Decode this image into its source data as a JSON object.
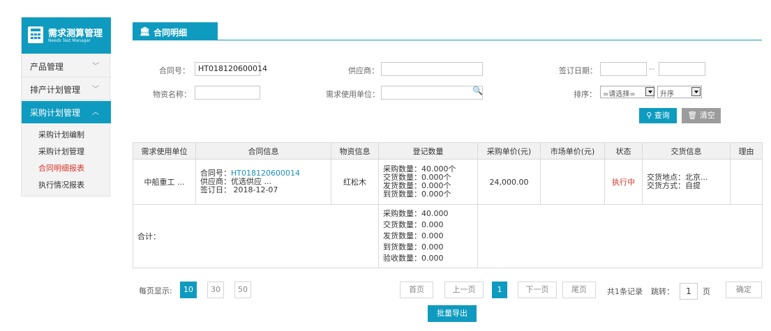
{
  "app": {
    "title": "需求测算管理",
    "subtitle": "Needs Test Manager"
  },
  "sidebar": {
    "menus": [
      {
        "label": "产品管理",
        "chevron": "﹀"
      },
      {
        "label": "排产计划管理",
        "chevron": "﹀"
      },
      {
        "label": "采购计划管理",
        "chevron": "︿"
      }
    ],
    "submenu": [
      "采购计划编制",
      "采购计划管理",
      "合同明细报表",
      "执行情况报表"
    ]
  },
  "header": {
    "tab_label": "合同明细",
    "tab_icon": "bank-icon"
  },
  "filters": {
    "contract_no_label": "合同号：",
    "contract_no_value": "HT018120600014",
    "supplier_label": "供应商：",
    "supplier_value": "",
    "sign_date_label": "签订日期：",
    "sign_date_sep": "--",
    "material_label": "物资名称：",
    "material_value": "",
    "unit_label": "需求使用单位：",
    "unit_value": "",
    "sort_label": "排序：",
    "sort_value": "=请选择=",
    "order_value": "升序",
    "query_label": "查询",
    "clear_label": "清空"
  },
  "table": {
    "headers": [
      "需求使用单位",
      "合同信息",
      "物资信息",
      "登记数量",
      "采购单价(元)",
      "市场单价(元)",
      "状态",
      "交货信息",
      "理由"
    ],
    "row": {
      "unit": "中船重工 ...",
      "contract_prefix": "合同号：",
      "contract_no": "HT018120600014",
      "supplier": "供应商：优选供应 ...",
      "sign_date": "签订日： 2018-12-07",
      "material": "红松木",
      "qty": [
        "采购数量：40.000个",
        "交货数量：0.000个",
        "发货数量：0.000个",
        "到货数量：0.000个"
      ],
      "purchase_price": "24,000.00",
      "market_price": "",
      "status": "执行中",
      "delivery": [
        "交货地点：北京...",
        "交货方式：自提"
      ],
      "reason": ""
    },
    "total": {
      "label": "合计：",
      "qty": [
        "采购数量：40.000",
        "交货数量：0.000",
        "发货数量：0.000",
        "到货数量：0.000",
        "验收数量：0.000"
      ]
    }
  },
  "pagination": {
    "per_page_label": "每页显示:",
    "sizes": [
      "10",
      "30",
      "50"
    ],
    "first": "首页",
    "prev": "上一页",
    "current": "1",
    "next": "下一页",
    "last": "尾页",
    "total": "共1条记录",
    "jump_label": "跳转：",
    "jump_value": "1",
    "page_unit": "页",
    "confirm": "确定"
  },
  "export_label": "批量导出"
}
